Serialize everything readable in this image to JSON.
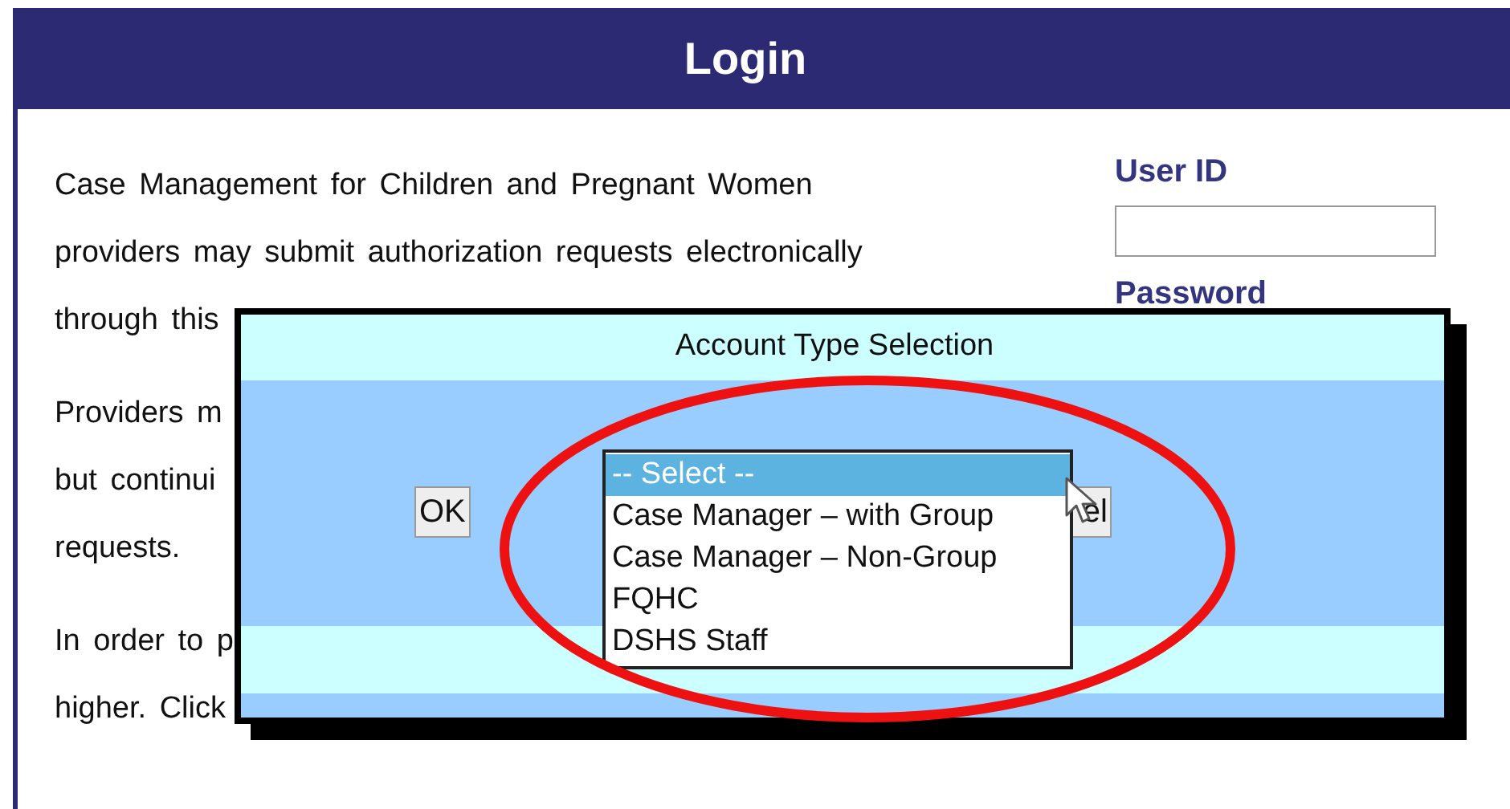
{
  "header": {
    "title": "Login"
  },
  "intro_paragraphs": [
    {
      "lines": [
        "Case Management for Children and Pregnant Women",
        "providers may submit authorization requests electronically",
        "through this"
      ]
    },
    {
      "lines": [
        "Providers m",
        "but continui",
        "requests."
      ]
    },
    {
      "lines": [
        "In order to p",
        "higher. Click"
      ]
    }
  ],
  "login_form": {
    "user_id_label": "User ID",
    "password_label": "Password"
  },
  "dialog": {
    "title": "Account Type Selection",
    "ok_button": "OK",
    "cancel_button": "el",
    "account_type_options": [
      {
        "label": "-- Select --",
        "selected": true
      },
      {
        "label": "Case Manager – with Group",
        "selected": false
      },
      {
        "label": "Case Manager – Non-Group",
        "selected": false
      },
      {
        "label": "FQHC",
        "selected": false
      },
      {
        "label": "DSHS Staff",
        "selected": false
      }
    ]
  }
}
